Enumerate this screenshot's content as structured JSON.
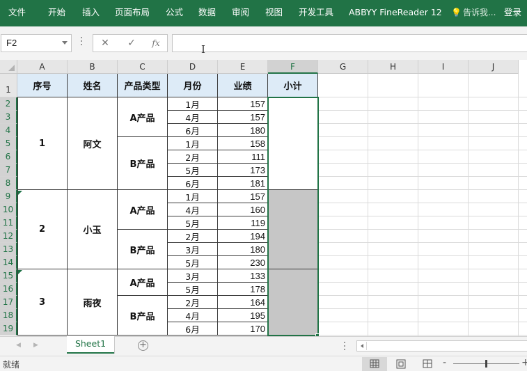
{
  "ribbon": {
    "tabs": [
      "文件",
      "开始",
      "插入",
      "页面布局",
      "公式",
      "数据",
      "审阅",
      "视图",
      "开发工具",
      "ABBYY FineReader 12"
    ],
    "tell_me": "告诉我...",
    "login": "登录"
  },
  "formula_bar": {
    "name_box": "F2",
    "cancel_icon": "✕",
    "enter_icon": "✓",
    "fx_label": "fx",
    "formula": ""
  },
  "columns": [
    "A",
    "B",
    "C",
    "D",
    "E",
    "F",
    "G",
    "H",
    "I",
    "J"
  ],
  "rows": [
    "1",
    "2",
    "3",
    "4",
    "5",
    "6",
    "7",
    "8",
    "9",
    "10",
    "11",
    "12",
    "13",
    "14",
    "15",
    "16",
    "17",
    "18",
    "19"
  ],
  "table": {
    "headers": [
      "序号",
      "姓名",
      "产品类型",
      "月份",
      "业绩",
      "小计"
    ],
    "groups": [
      {
        "no": "1",
        "name": "阿文",
        "products": [
          {
            "type": "A产品",
            "rows": [
              [
                "1月",
                "157"
              ],
              [
                "4月",
                "157"
              ],
              [
                "6月",
                "180"
              ]
            ]
          },
          {
            "type": "B产品",
            "rows": [
              [
                "1月",
                "158"
              ],
              [
                "2月",
                "111"
              ],
              [
                "5月",
                "173"
              ],
              [
                "6月",
                "181"
              ]
            ]
          }
        ]
      },
      {
        "no": "2",
        "name": "小玉",
        "products": [
          {
            "type": "A产品",
            "rows": [
              [
                "1月",
                "157"
              ],
              [
                "4月",
                "160"
              ],
              [
                "5月",
                "119"
              ]
            ]
          },
          {
            "type": "B产品",
            "rows": [
              [
                "2月",
                "194"
              ],
              [
                "3月",
                "180"
              ],
              [
                "5月",
                "230"
              ]
            ]
          }
        ]
      },
      {
        "no": "3",
        "name": "雨夜",
        "products": [
          {
            "type": "A产品",
            "rows": [
              [
                "3月",
                "133"
              ],
              [
                "5月",
                "178"
              ]
            ]
          },
          {
            "type": "B产品",
            "rows": [
              [
                "2月",
                "164"
              ],
              [
                "4月",
                "195"
              ],
              [
                "6月",
                "170"
              ]
            ]
          }
        ]
      }
    ]
  },
  "sheet_tabs": [
    "Sheet1"
  ],
  "status": {
    "ready": "就绪"
  },
  "colors": {
    "accent": "#217346",
    "header_fill": "#DDEBF7",
    "selected_fill": "#C6C6C6"
  }
}
